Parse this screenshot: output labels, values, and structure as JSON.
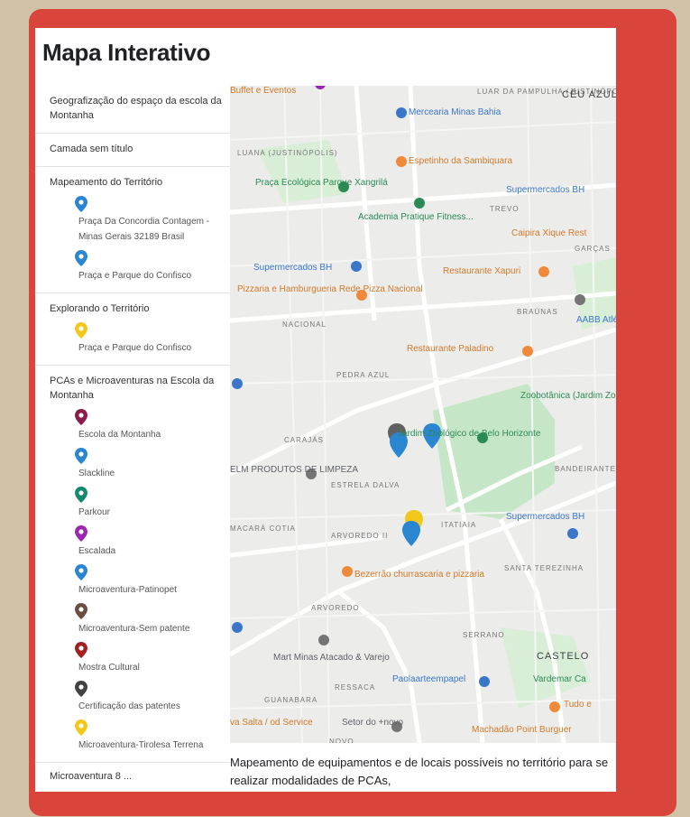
{
  "page_title": "Mapa Interativo",
  "legend": {
    "sections": [
      {
        "title": "Geografização do espaço da escola da Montanha",
        "items": []
      },
      {
        "title": "Camada sem título",
        "items": []
      },
      {
        "title": "Mapeamento do Território",
        "items": [
          {
            "label": "Praça Da Concordia Contagem - Minas Gerais 32189 Brasil",
            "color": "#2a86d1"
          },
          {
            "label": "Praça e Parque do Confisco",
            "color": "#2a86d1"
          }
        ]
      },
      {
        "title": "Explorando o Território",
        "items": [
          {
            "label": "Praça e Parque do Confisco",
            "color": "#f2c81c"
          }
        ]
      },
      {
        "title": "PCAs e Microaventuras na Escola da Montanha",
        "items": [
          {
            "label": "Escola da Montanha",
            "color": "#8c1d4a"
          },
          {
            "label": "Slackline",
            "color": "#2a86d1"
          },
          {
            "label": "Parkour",
            "color": "#138a6e"
          },
          {
            "label": "Escalada",
            "color": "#9c27b0"
          },
          {
            "label": "Microaventura-Patinopet",
            "color": "#2a86d1"
          },
          {
            "label": "Microaventura-Sem patente",
            "color": "#6d4c41"
          },
          {
            "label": "Mostra Cultural",
            "color": "#a32020"
          },
          {
            "label": "Certificação das patentes",
            "color": "#424242"
          },
          {
            "label": "Microaventura-Tirolesa Terrena",
            "color": "#f2c81c"
          }
        ]
      }
    ],
    "cutoff_text": "Microaventura 8 ..."
  },
  "map": {
    "labels": [
      {
        "text": "Buffet e Eventos",
        "style": "orange"
      },
      {
        "text": "LUAR DA PAMPULHA (JUSTINÓPOLIS)",
        "style": "small"
      },
      {
        "text": "CÉU AZUL",
        "style": "dark"
      },
      {
        "text": "Mercearia Minas Bahia",
        "style": "blue"
      },
      {
        "text": "LUANA (JUSTINÓPOLIS)",
        "style": "small"
      },
      {
        "text": "Espetinho da Sambiquara",
        "style": "orange"
      },
      {
        "text": "Praça Ecológica Parque Xangrilá",
        "style": "green"
      },
      {
        "text": "Supermercados BH",
        "style": "blue"
      },
      {
        "text": "Academia Pratique Fitness...",
        "style": "green"
      },
      {
        "text": "TREVO",
        "style": "small"
      },
      {
        "text": "Caipira Xique Rest",
        "style": "orange"
      },
      {
        "text": "GARÇAS",
        "style": "small"
      },
      {
        "text": "Supermercados BH",
        "style": "blue"
      },
      {
        "text": "Restaurante Xapuri",
        "style": "orange"
      },
      {
        "text": "Pizzaria e Hamburgueria Rede Pizza Nacional",
        "style": "orange"
      },
      {
        "text": "BRAÚNAS",
        "style": "small"
      },
      {
        "text": "AABB Atlética",
        "style": "blue"
      },
      {
        "text": "NACIONAL",
        "style": "small"
      },
      {
        "text": "Restaurante Paladino",
        "style": "orange"
      },
      {
        "text": "PEDRA AZUL",
        "style": "small"
      },
      {
        "text": "Zoobotânica (Jardim Zoológico e Botânico) de...",
        "style": "green"
      },
      {
        "text": "Jardim Zoológico de Belo Horizonte",
        "style": "green"
      },
      {
        "text": "CARAJÁS",
        "style": "small"
      },
      {
        "text": "ELM PRODUTOS DE LIMPEZA",
        "style": "default"
      },
      {
        "text": "ESTRELA DALVA",
        "style": "small"
      },
      {
        "text": "BANDEIRANTES (PAMPULHA)",
        "style": "small"
      },
      {
        "text": "MACARÁ COTIA",
        "style": "small"
      },
      {
        "text": "ARVOREDO II",
        "style": "small"
      },
      {
        "text": "ITATIAIA",
        "style": "small"
      },
      {
        "text": "Supermercados BH",
        "style": "blue"
      },
      {
        "text": "Bezerrão churrascaria e pizzaria",
        "style": "orange"
      },
      {
        "text": "SANTA TEREZINHA",
        "style": "small"
      },
      {
        "text": "ARVOREDO",
        "style": "small"
      },
      {
        "text": "SERRANO",
        "style": "small"
      },
      {
        "text": "Mart Minas Atacado & Varejo",
        "style": "default"
      },
      {
        "text": "CASTELO",
        "style": "dark"
      },
      {
        "text": "RESSACA",
        "style": "small"
      },
      {
        "text": "Paolaarteempapel",
        "style": "blue"
      },
      {
        "text": "Vardemar Ca",
        "style": "green"
      },
      {
        "text": "GUANABARA",
        "style": "small"
      },
      {
        "text": "Tudo e",
        "style": "orange"
      },
      {
        "text": "Setor do +novo",
        "style": "default"
      },
      {
        "text": "va Salta / od Service",
        "style": "orange"
      },
      {
        "text": "NOVO",
        "style": "small"
      },
      {
        "text": "Machadão Point Burguer",
        "style": "orange"
      }
    ]
  },
  "description": "Mapeamento de equipamentos e de locais possíveis no território para se realizar modalidades de PCAs,"
}
